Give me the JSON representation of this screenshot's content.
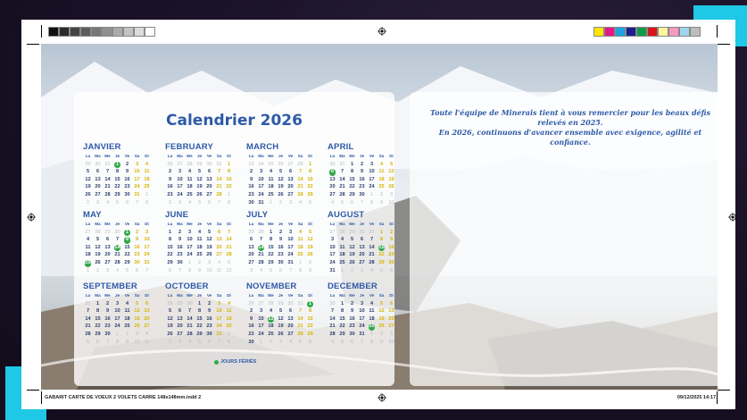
{
  "colorbar_gray": [
    "#111111",
    "#2b2b2b",
    "#444444",
    "#5d5d5d",
    "#777777",
    "#909090",
    "#aaaaaa",
    "#c3c3c3",
    "#dcdcdc",
    "#ffffff"
  ],
  "colorbar_color": [
    "#ffe600",
    "#e8168b",
    "#1aa3e0",
    "#1d1d8c",
    "#0e9b48",
    "#d9141a",
    "#fff799",
    "#f49ac1",
    "#9fd5f0",
    "#bdbdbd"
  ],
  "calendar": {
    "title": "Calendrier 2026",
    "weekday_headers": [
      "Lu",
      "Ma",
      "Me",
      "Je",
      "Ve",
      "Sa",
      "Di"
    ],
    "legend_label": "JOURS FÉRIÉS",
    "months": [
      {
        "name": "JANVIER",
        "first": 3,
        "days": 31,
        "prev": 31,
        "holidays": [
          1
        ]
      },
      {
        "name": "FEBRUARY",
        "first": 6,
        "days": 28,
        "prev": 31,
        "holidays": []
      },
      {
        "name": "MARCH",
        "first": 6,
        "days": 31,
        "prev": 28,
        "holidays": []
      },
      {
        "name": "APRIL",
        "first": 2,
        "days": 30,
        "prev": 31,
        "holidays": [
          6
        ]
      },
      {
        "name": "MAY",
        "first": 4,
        "days": 31,
        "prev": 30,
        "holidays": [
          1,
          8,
          14,
          25
        ]
      },
      {
        "name": "JUNE",
        "first": 0,
        "days": 30,
        "prev": 31,
        "holidays": []
      },
      {
        "name": "JULY",
        "first": 2,
        "days": 31,
        "prev": 30,
        "holidays": [
          14
        ]
      },
      {
        "name": "AUGUST",
        "first": 5,
        "days": 31,
        "prev": 31,
        "holidays": [
          15
        ]
      },
      {
        "name": "SEPTEMBER",
        "first": 1,
        "days": 30,
        "prev": 31,
        "holidays": []
      },
      {
        "name": "OCTOBER",
        "first": 3,
        "days": 31,
        "prev": 30,
        "holidays": []
      },
      {
        "name": "NOVEMBER",
        "first": 6,
        "days": 30,
        "prev": 31,
        "holidays": [
          1,
          11
        ]
      },
      {
        "name": "DECEMBER",
        "first": 1,
        "days": 31,
        "prev": 30,
        "holidays": [
          25
        ]
      }
    ]
  },
  "message": {
    "line1": "Toute l'équipe de Minerais tient à vous remercier pour les beaux défis relevés en 2025.",
    "line2": "En 2026, continuons d'avancer ensemble avec exigence, agilité et confiance."
  },
  "footer": {
    "file": "GABARIT CARTE DE VOEUX 2 VOLETS CARRE 148x148mm.indd   2",
    "date": "09/12/2025   14:17"
  }
}
